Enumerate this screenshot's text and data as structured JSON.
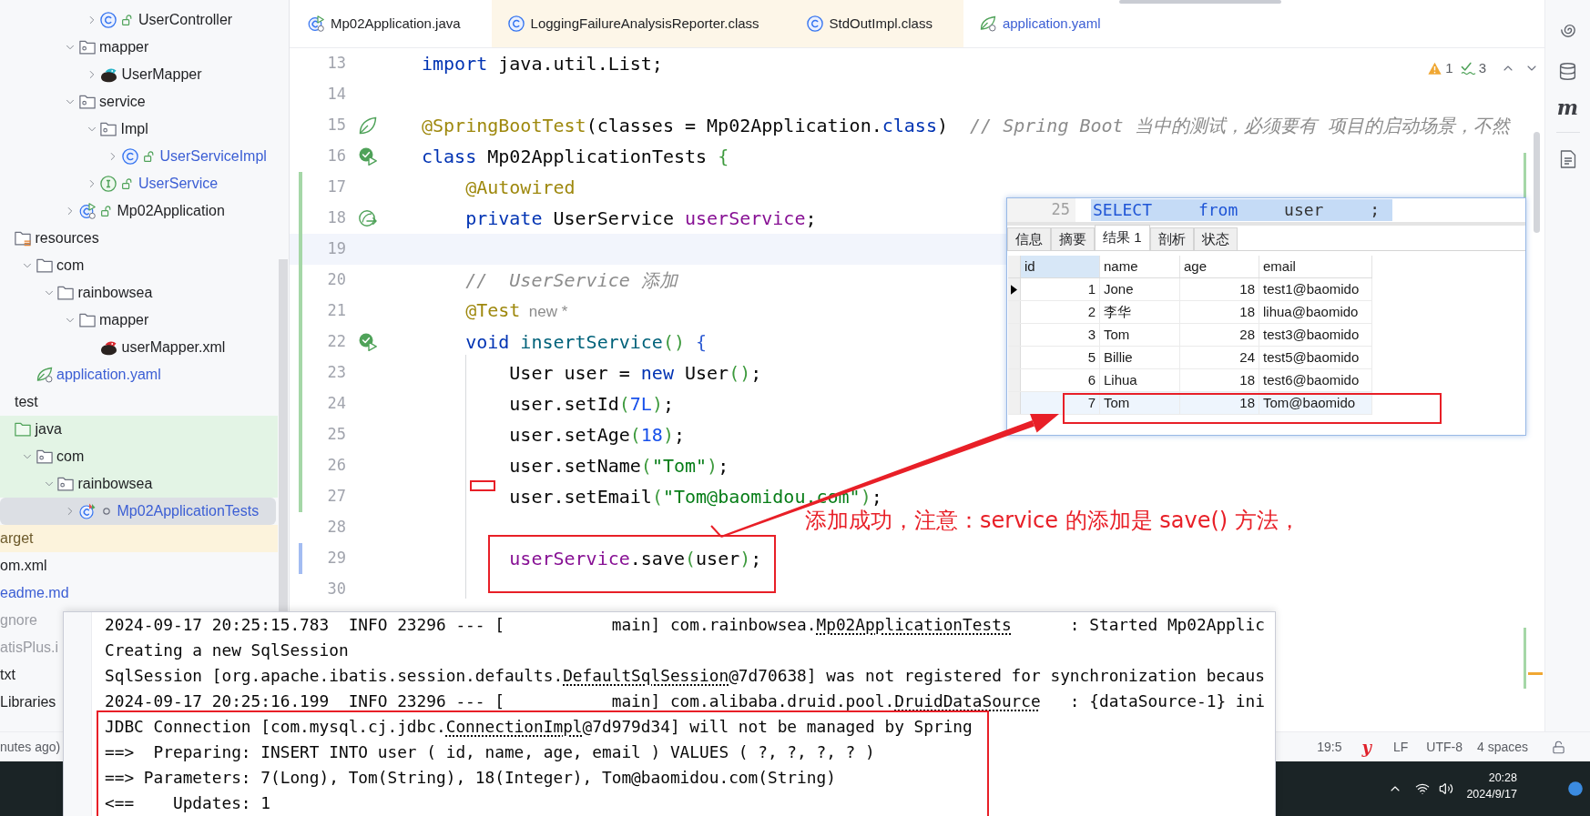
{
  "tabs": [
    {
      "label": "Mp02Application.java",
      "kind": "app"
    },
    {
      "label": "LoggingFailureAnalysisReporter.class",
      "kind": "library"
    },
    {
      "label": "StdOutImpl.class",
      "kind": "library"
    },
    {
      "label": "application.yaml",
      "kind": "config",
      "modified": true
    }
  ],
  "project_tree": [
    {
      "children": [
        {
          "children": [
            {
              "children": [
                {
                  "children": [
                    {
                      "children": [
                        {
                          "children": [
                            {
                              "label": "UserController",
                              "kind": "class",
                              "public": true,
                              "expanded": false,
                              "selected": false
                            }
                          ]
                        },
                        {
                          "label": "mapper",
                          "kind": "package",
                          "expanded": true,
                          "selected": false,
                          "children": [
                            {
                              "label": "UserMapper",
                              "kind": "mapper",
                              "expanded": false,
                              "selected": false
                            }
                          ]
                        },
                        {
                          "label": "service",
                          "kind": "package",
                          "expanded": true,
                          "selected": false,
                          "children": [
                            {
                              "label": "Impl",
                              "kind": "package",
                              "expanded": true,
                              "selected": false,
                              "children": [
                                {
                                  "label": "UserServiceImpl",
                                  "kind": "class",
                                  "public": true,
                                  "expanded": false,
                                  "selected": false,
                                  "modified": true
                                }
                              ]
                            },
                            {
                              "label": "UserService",
                              "kind": "interface",
                              "public": true,
                              "expanded": false,
                              "selected": false,
                              "modified": true
                            }
                          ]
                        },
                        {
                          "label": "Mp02Application",
                          "kind": "app",
                          "public": true,
                          "expanded": false,
                          "selected": false
                        }
                      ]
                    }
                  ]
                }
              ]
            },
            {
              "label": "resources",
              "kind": "resources",
              "selected": false,
              "children": [
                {
                  "label": "com",
                  "kind": "folder",
                  "expanded": true,
                  "selected": false,
                  "children": [
                    {
                      "label": "rainbowsea",
                      "kind": "folder",
                      "expanded": true,
                      "selected": false,
                      "children": [
                        {
                          "label": "mapper",
                          "kind": "folder",
                          "expanded": true,
                          "selected": false,
                          "children": [
                            {
                              "label": "userMapper.xml",
                              "kind": "mapper-xml",
                              "selected": false
                            }
                          ]
                        }
                      ]
                    }
                  ]
                },
                {
                  "label": "application.yaml",
                  "kind": "yaml",
                  "selected": false,
                  "modified": true
                }
              ]
            }
          ]
        },
        {
          "label": "test",
          "selected": false,
          "children": [
            {
              "label": "java",
              "kind": "test-root",
              "selected": false,
              "test_scope": true,
              "children": [
                {
                  "label": "com",
                  "kind": "package",
                  "expanded": true,
                  "selected": false,
                  "test_scope": true,
                  "children": [
                    {
                      "label": "rainbowsea",
                      "kind": "package",
                      "expanded": true,
                      "selected": false,
                      "test_scope": true,
                      "children": [
                        {
                          "label": "Mp02ApplicationTests",
                          "kind": "test-class",
                          "public": false,
                          "expanded": false,
                          "selected": true,
                          "modified": true
                        }
                      ]
                    }
                  ]
                }
              ]
            }
          ]
        }
      ]
    },
    {
      "label": "arget",
      "selected": false,
      "excluded": true
    },
    {
      "label": "om.xml",
      "selected": false
    },
    {
      "label": "eadme.md",
      "selected": false,
      "modified": true
    },
    {
      "label": "gnore",
      "selected": false,
      "ignored": true
    },
    {
      "label": "atisPlus.i",
      "selected": false,
      "ignored": true
    },
    {
      "label": "txt",
      "selected": false
    },
    {
      "label": "Libraries",
      "selected": false
    }
  ],
  "editor": {
    "inspections": {
      "warnings": "1",
      "weak_warnings": "3"
    },
    "lines": [
      {
        "number": "13",
        "tokens": [
          {
            "text": "import",
            "kind": "keyword"
          },
          {
            "text": " java.util.List;",
            "kind": "plain"
          }
        ]
      },
      {
        "number": "14"
      },
      {
        "number": "15",
        "gutter": {
          "kind": "bean"
        },
        "tokens": [
          {
            "text": "@SpringBootTest",
            "kind": "annotation"
          },
          {
            "text": "(classes = Mp02Application.",
            "kind": "plain"
          },
          {
            "text": "class",
            "kind": "keyword"
          },
          {
            "text": ")",
            "kind": "plain"
          },
          {
            "text": "  // Spring Boot 当中的测试，必须要有 项目的启动场景，不然",
            "kind": "comment"
          }
        ]
      },
      {
        "number": "16",
        "gutter": {
          "kind": "run"
        },
        "tokens": [
          {
            "text": "class",
            "kind": "keyword"
          },
          {
            "text": " Mp02ApplicationTests",
            "kind": "plain"
          },
          {
            "text": " {",
            "kind": "bracket"
          }
        ]
      },
      {
        "number": "17",
        "added": true,
        "tokens": [
          {
            "text": "    @Autowired",
            "kind": "annotation"
          }
        ]
      },
      {
        "number": "18",
        "added": true,
        "gutter": {
          "kind": "inject"
        },
        "tokens": [
          {
            "text": "    private",
            "kind": "keyword"
          },
          {
            "text": " UserService ",
            "kind": "plain"
          },
          {
            "text": "userService",
            "kind": "field"
          },
          {
            "text": ";",
            "kind": "plain"
          }
        ]
      },
      {
        "number": "19",
        "added": true,
        "current": true
      },
      {
        "number": "20",
        "added": true,
        "tokens": [
          {
            "text": "    //  UserService 添加",
            "kind": "comment"
          }
        ]
      },
      {
        "number": "21",
        "added": true,
        "tokens": [
          {
            "text": "    @Test",
            "kind": "annotation"
          },
          {
            "text": "  new *",
            "kind": "hint"
          }
        ]
      },
      {
        "number": "22",
        "added": true,
        "gutter": {
          "kind": "run"
        },
        "tokens": [
          {
            "text": "    void",
            "kind": "keyword"
          },
          {
            "text": " insertService",
            "kind": "method"
          },
          {
            "text": "()",
            "kind": "bracket"
          },
          {
            "text": " {",
            "kind": "brace"
          }
        ]
      },
      {
        "number": "23",
        "added": true,
        "tokens": [
          {
            "text": "        User user = ",
            "kind": "plain"
          },
          {
            "text": "new",
            "kind": "keyword"
          },
          {
            "text": " User",
            "kind": "plain"
          },
          {
            "text": "()",
            "kind": "bracket"
          },
          {
            "text": ";",
            "kind": "plain"
          }
        ]
      },
      {
        "number": "24",
        "added": true,
        "tokens": [
          {
            "text": "        user.setId",
            "kind": "plain"
          },
          {
            "text": "(",
            "kind": "bracket"
          },
          {
            "text": "7L",
            "kind": "number"
          },
          {
            "text": ")",
            "kind": "bracket"
          },
          {
            "text": ";",
            "kind": "plain"
          }
        ]
      },
      {
        "number": "25",
        "added": true,
        "tokens": [
          {
            "text": "        user.setAge",
            "kind": "plain"
          },
          {
            "text": "(",
            "kind": "bracket"
          },
          {
            "text": "18",
            "kind": "number"
          },
          {
            "text": ")",
            "kind": "bracket"
          },
          {
            "text": ";",
            "kind": "plain"
          }
        ]
      },
      {
        "number": "26",
        "added": true,
        "tokens": [
          {
            "text": "        user.setName",
            "kind": "plain"
          },
          {
            "text": "(",
            "kind": "bracket"
          },
          {
            "text": "\"Tom\"",
            "kind": "string"
          },
          {
            "text": ")",
            "kind": "bracket"
          },
          {
            "text": ";",
            "kind": "plain"
          }
        ]
      },
      {
        "number": "27",
        "added": true,
        "tokens": [
          {
            "text": "        user.setEmail",
            "kind": "plain"
          },
          {
            "text": "(",
            "kind": "bracket"
          },
          {
            "text": "\"Tom@baomidou.com\"",
            "kind": "string"
          },
          {
            "text": ")",
            "kind": "bracket"
          },
          {
            "text": ";",
            "kind": "plain"
          }
        ]
      },
      {
        "number": "28"
      },
      {
        "number": "29",
        "modified": true,
        "tokens": [
          {
            "text": "        userService",
            "kind": "field"
          },
          {
            "text": ".save",
            "kind": "plain"
          },
          {
            "text": "(",
            "kind": "bracket"
          },
          {
            "text": "user",
            "kind": "plain"
          },
          {
            "text": ")",
            "kind": "bracket"
          },
          {
            "text": ";",
            "kind": "plain"
          }
        ]
      },
      {
        "number": "30"
      }
    ]
  },
  "right_toolbar": {
    "label": "m"
  },
  "query_result": {
    "sql": {
      "line_number": "25",
      "tokens": [
        {
          "text": "SELECT",
          "kind": "keyword"
        },
        {
          "text": "from",
          "kind": "keyword"
        },
        {
          "text": "user",
          "kind": "name"
        },
        {
          "text": ";",
          "kind": "plain"
        }
      ]
    },
    "tabs": [
      {
        "label": "信息",
        "selected": false
      },
      {
        "label": "摘要",
        "selected": false
      },
      {
        "label": "结果 1",
        "selected": true
      },
      {
        "label": "剖析",
        "selected": false
      },
      {
        "label": "状态",
        "selected": false
      }
    ],
    "columns": [
      {
        "label": "id",
        "kind": "number",
        "selected": true
      },
      {
        "label": "name",
        "kind": "text",
        "selected": false
      },
      {
        "label": "age",
        "kind": "number",
        "selected": false
      },
      {
        "label": "email",
        "kind": "text",
        "selected": false
      }
    ],
    "rows": [
      {
        "cells": [
          "1",
          "Jone",
          "18",
          "test1@baomido"
        ],
        "current": true,
        "selected": false
      },
      {
        "cells": [
          "2",
          "李华",
          "18",
          "lihua@baomido"
        ],
        "current": false,
        "selected": false
      },
      {
        "cells": [
          "3",
          "Tom",
          "28",
          "test3@baomido"
        ],
        "current": false,
        "selected": false
      },
      {
        "cells": [
          "5",
          "Billie",
          "24",
          "test5@baomido"
        ],
        "current": false,
        "selected": false
      },
      {
        "cells": [
          "6",
          "Lihua",
          "18",
          "test6@baomido"
        ],
        "current": false,
        "selected": false
      },
      {
        "cells": [
          "7",
          "Tom",
          "18",
          "Tom@baomido"
        ],
        "current": false,
        "selected": true
      }
    ]
  },
  "annotation": {
    "note": "添加成功，注意：service 的添加是 save() 方法，"
  },
  "console": {
    "lines": [
      {
        "segments": [
          {
            "text": "2024-09-17 20:25:15.783  INFO 23296 --- [           main] com.rainbowsea."
          },
          {
            "text": "Mp02ApplicationTests",
            "link": true
          },
          {
            "text": "      : Started Mp02Applic"
          }
        ]
      },
      {
        "segments": [
          {
            "text": "Creating a new SqlSession"
          }
        ]
      },
      {
        "segments": [
          {
            "text": "SqlSession [org.apache.ibatis.session.defaults."
          },
          {
            "text": "DefaultSqlSession",
            "link": true
          },
          {
            "text": "@7d70638] was not registered for synchronization becaus"
          }
        ]
      },
      {
        "segments": [
          {
            "text": "2024-09-17 20:25:16.199  INFO 23296 --- [           main] com.alibaba.druid.pool."
          },
          {
            "text": "DruidDataSource",
            "link": true
          },
          {
            "text": "   : {dataSource-1} ini"
          }
        ]
      },
      {
        "segments": [
          {
            "text": "JDBC Connection [com.mysql.cj.jdbc."
          },
          {
            "text": "ConnectionImpl",
            "link": true
          },
          {
            "text": "@7d979d34] will not be managed by Spring"
          }
        ]
      },
      {
        "segments": [
          {
            "text": "==>  Preparing: INSERT INTO user ( id, name, age, email ) VALUES ( ?, ?, ?, ? )"
          }
        ]
      },
      {
        "segments": [
          {
            "text": "==> Parameters: 7(Long), Tom(String), 18(Integer), Tom@baomidou.com(String)"
          }
        ]
      },
      {
        "segments": [
          {
            "text": "<==    Updates: 1"
          }
        ]
      }
    ]
  },
  "status_bar": {
    "message": "nutes ago)",
    "position": "19:5",
    "plugin": "y",
    "line_separator": "LF",
    "encoding": "UTF-8",
    "indent": "4 spaces"
  },
  "taskbar": {
    "time": "20:28",
    "date": "2024/9/17"
  }
}
